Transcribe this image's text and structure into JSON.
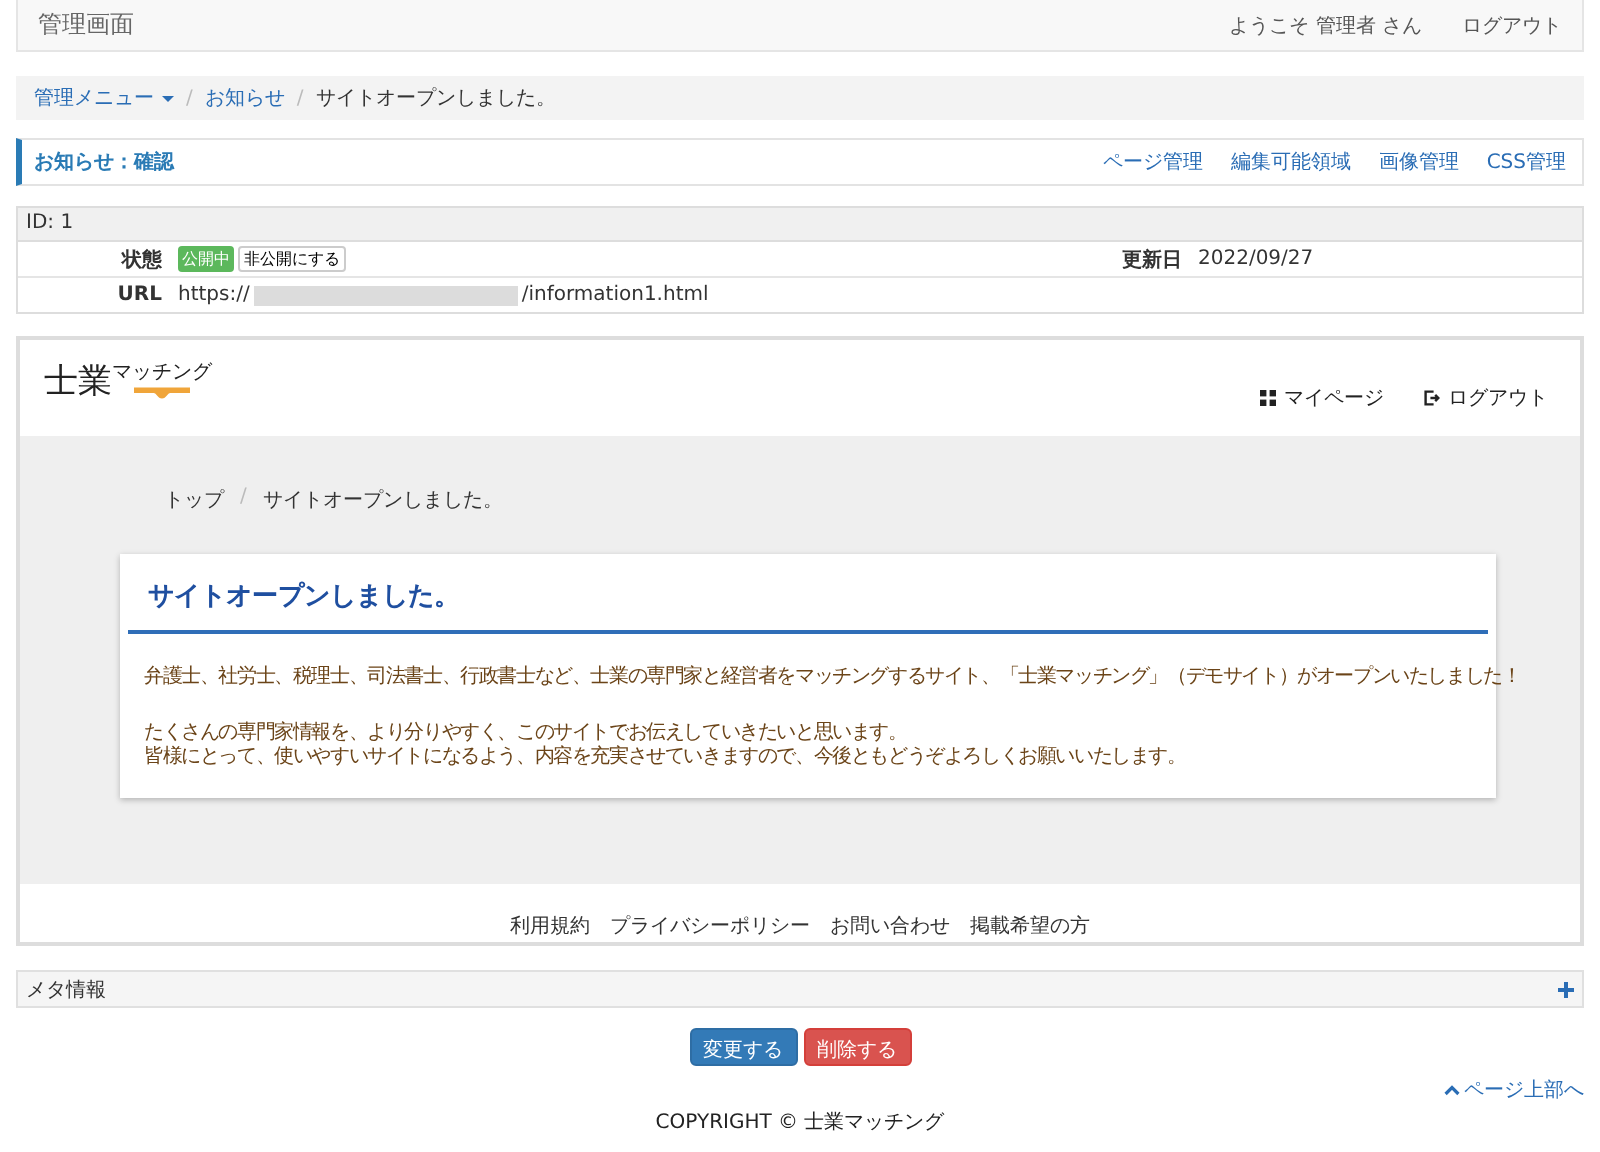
{
  "header": {
    "title": "管理画面",
    "welcome": "ようこそ 管理者 さん",
    "logout": "ログアウト"
  },
  "breadcrumb": [
    {
      "label": "管理メニュー",
      "dropdown": true
    },
    {
      "separator": "/",
      "label": "お知らせ",
      "dropdown": false
    },
    {
      "separator": "/",
      "label": "サイトオープンしました。",
      "dropdown": false
    }
  ],
  "panel": {
    "title": "お知らせ：確認",
    "links": [
      "ページ管理",
      "編集可能領域",
      "画像管理",
      "CSS管理"
    ]
  },
  "info": {
    "id": "ID: 1",
    "status_label": "状態",
    "status_badge": "公開中",
    "status_button": "非公開にする",
    "updated_label": "更新日",
    "updated": "2022/09/27",
    "url_label": "URL",
    "url_prefix": "https://",
    "url_suffix": "/information1.html"
  },
  "preview": {
    "logo_main": "士業",
    "logo_sub": "マッチング",
    "nav": [
      {
        "label": "マイページ",
        "kind": "grid"
      },
      {
        "label": "ログアウト",
        "kind": "logout"
      }
    ],
    "crumbs": [
      {
        "label": "トップ"
      },
      {
        "separator": "/",
        "label": "サイトオープンしました。"
      }
    ],
    "article_title": "サイトオープンしました。",
    "paragraphs": [
      [
        "弁護士、社労士、税理士、司法書士、行政書士など、士業の専門家と経営者をマッチングするサイト、「士業マッチング」（デモサイト）がオープンいたしました！"
      ],
      [
        "たくさんの専門家情報を、より分りやすく、このサイトでお伝えしていきたいと思います。",
        "皆様にとって、使いやすいサイトになるよう、内容を充実させていきますので、今後ともどうぞよろしくお願いいたします。"
      ]
    ],
    "footer_links": [
      "利用規約",
      "プライバシーポリシー",
      "お問い合わせ",
      "掲載希望の方"
    ]
  },
  "meta": {
    "label": "メタ情報",
    "expanded": false
  },
  "buttons": [
    {
      "label": "変更する",
      "kind": "primary"
    },
    {
      "label": "削除する",
      "kind": "danger"
    }
  ],
  "page_top": "ページ上部へ",
  "copyright": "COPYRIGHT © 士業マッチング"
}
